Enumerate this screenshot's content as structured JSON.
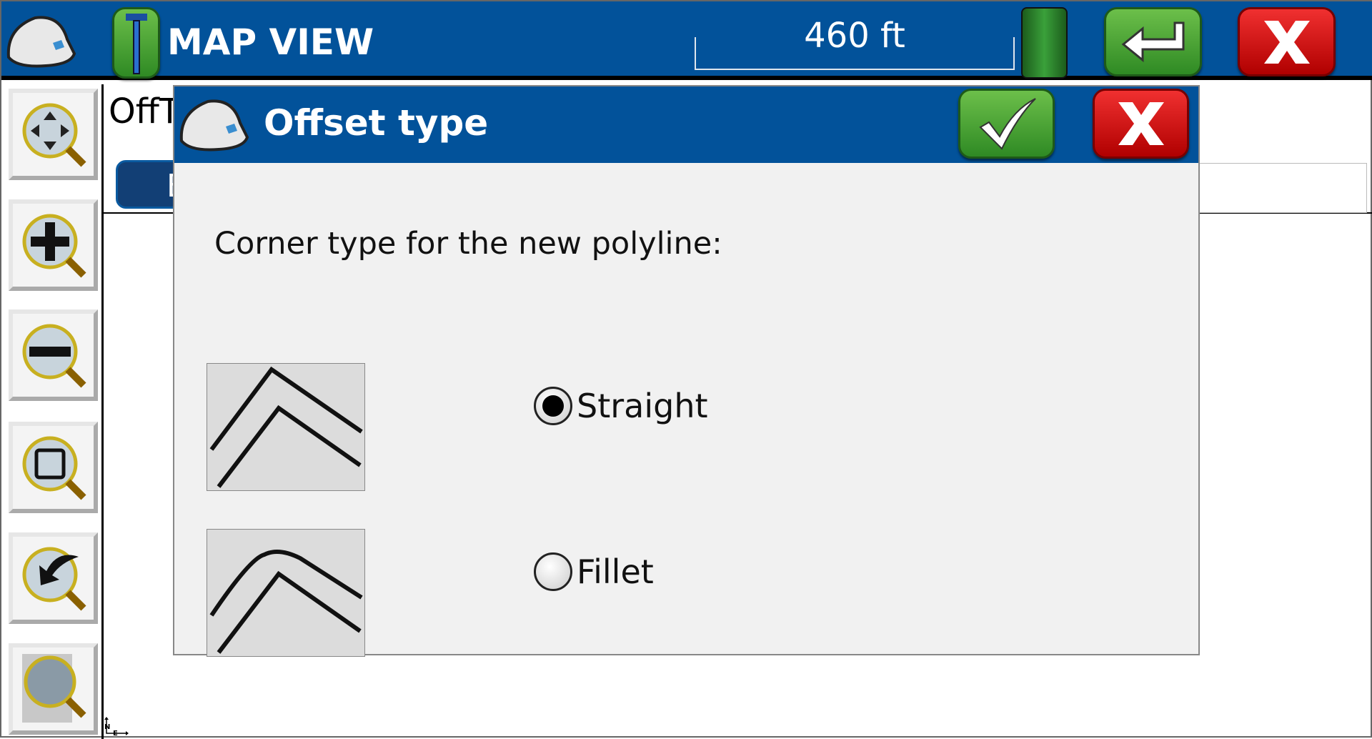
{
  "header": {
    "title": "MAP VIEW",
    "scale": "460 ft",
    "icons": [
      "hard-hat-icon",
      "gps-rover-icon",
      "battery-icon",
      "enter-icon",
      "close-icon"
    ]
  },
  "sidebar": {
    "tools": [
      "pan-zoom",
      "zoom-in",
      "zoom-out",
      "zoom-extents",
      "zoom-previous",
      "zoom-list"
    ]
  },
  "background": {
    "label": "OffT",
    "button_label": "E",
    "compass": {
      "north": "N",
      "east": "E"
    }
  },
  "dialog": {
    "title": "Offset type",
    "prompt": "Corner type for the new polyline:",
    "options": [
      {
        "label": "Straight",
        "selected": true
      },
      {
        "label": "Fillet",
        "selected": false
      }
    ]
  },
  "colors": {
    "header_blue": "#02529a",
    "ok_green": "#3a9a2c",
    "cancel_red": "#d40f0f"
  }
}
